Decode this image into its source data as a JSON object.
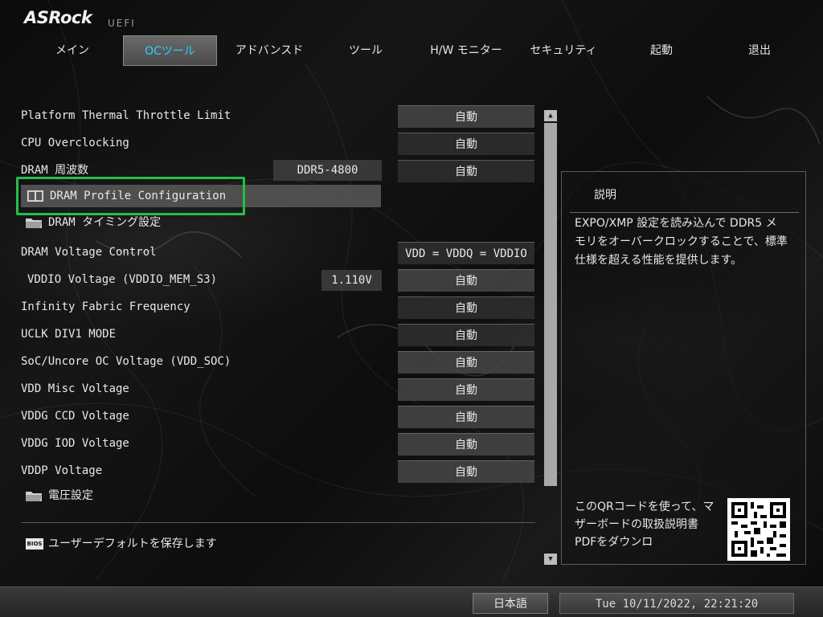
{
  "header": {
    "logo": "ASRock",
    "logo_sub": "UEFI",
    "tabs": [
      "メイン",
      "OCツール",
      "アドバンスド",
      "ツール",
      "H/W モニター",
      "セキュリティ",
      "起動",
      "退出"
    ],
    "active_tab": "OCツール"
  },
  "settings": {
    "platform_thermal": {
      "label": "Platform Thermal Throttle Limit",
      "value": "自動"
    },
    "cpu_oc": {
      "label": "CPU Overclocking",
      "value": "自動"
    },
    "dram_freq": {
      "label": "DRAM 周波数",
      "current": "DDR5-4800",
      "value": "自動"
    },
    "dram_profile": {
      "label": "DRAM Profile Configuration"
    },
    "dram_timing": {
      "label": "DRAM タイミング設定"
    },
    "dram_voltage_control": {
      "label": "DRAM Voltage Control",
      "value": "VDD = VDDQ = VDDIO"
    },
    "vddio_voltage": {
      "label": "VDDIO Voltage (VDDIO_MEM_S3)",
      "current": "1.110V",
      "value": "自動"
    },
    "infinity_fabric": {
      "label": "Infinity Fabric Frequency",
      "value": "自動"
    },
    "uclk_div1": {
      "label": "UCLK DIV1 MODE",
      "value": "自動"
    },
    "soc_voltage": {
      "label": "SoC/Uncore OC Voltage (VDD_SOC)",
      "value": "自動"
    },
    "vdd_misc": {
      "label": "VDD Misc Voltage",
      "value": "自動"
    },
    "vddg_ccd": {
      "label": "VDDG CCD Voltage",
      "value": "自動"
    },
    "vddg_iod": {
      "label": "VDDG IOD Voltage",
      "value": "自動"
    },
    "vddp": {
      "label": "VDDP Voltage",
      "value": "自動"
    },
    "voltage_settings": {
      "label": "電圧設定"
    }
  },
  "save_user_default": {
    "icon_text": "BIOS",
    "label": "ユーザーデフォルトを保存します"
  },
  "description": {
    "title": "説明",
    "text": "EXPO/XMP 設定を読み込んで DDR5 メモリをオーバークロックすることで、標準仕様を超える性能を提供します。",
    "qr_text": "このQRコードを使って、マザーボードの取扱説明書PDFをダウンロ"
  },
  "footer": {
    "language": "日本語",
    "datetime": "Tue 10/11/2022, 22:21:20"
  },
  "colors": {
    "active_tab_text": "#2fd0ff",
    "selection_border": "#22c04a"
  }
}
